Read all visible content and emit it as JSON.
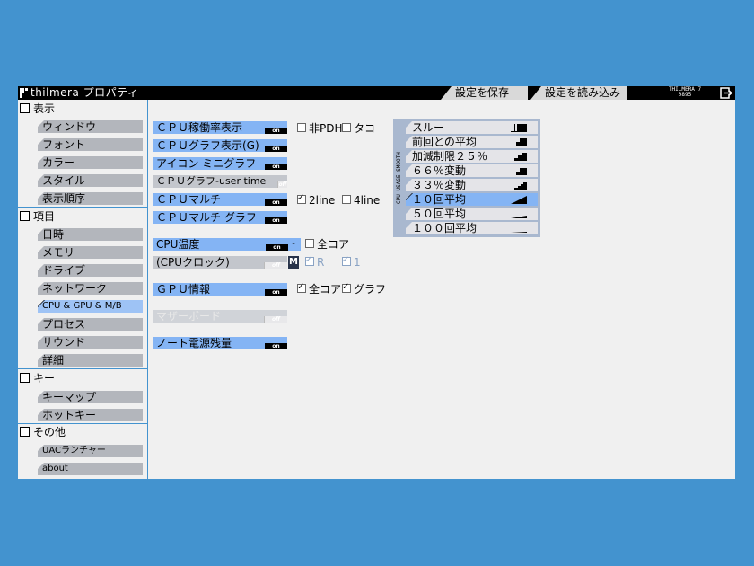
{
  "titlebar": {
    "title": "thilmera プロパティ",
    "save_label": "設定を保存",
    "load_label": "設定を読み込み",
    "brand_line1": "THILMERA 7",
    "brand_line2": "0895"
  },
  "sidebar": {
    "sections": [
      {
        "label": "表示",
        "items": [
          "ウィンドウ",
          "フォント",
          "カラー",
          "スタイル",
          "表示順序"
        ]
      },
      {
        "label": "項目",
        "items": [
          "日時",
          "メモリ",
          "ドライブ",
          "ネットワーク",
          "CPU & GPU & M/B",
          "プロセス",
          "サウンド",
          "詳細"
        ],
        "selected": "CPU & GPU & M/B"
      },
      {
        "label": "キー",
        "items": [
          "キーマップ",
          "ホットキー"
        ]
      },
      {
        "label": "その他",
        "items": [
          "UACランチャー",
          "about"
        ]
      }
    ]
  },
  "main": {
    "toggles": [
      {
        "label": "ＣＰＵ稼働率表示",
        "state": "on"
      },
      {
        "label": "ＣＰＵグラフ表示(G)",
        "state": "on"
      },
      {
        "label": "アイコン ミニグラフ",
        "state": "on"
      },
      {
        "label": "ＣＰＵグラフ-user time",
        "state": "off"
      },
      {
        "label": "ＣＰＵマルチ",
        "state": "on"
      },
      {
        "label": "ＣＰＵマルチ グラフ",
        "state": "on"
      },
      {
        "label": "CPU温度",
        "state": "on"
      },
      {
        "label": "(CPUクロック)",
        "state": "off"
      },
      {
        "label": "ＧＰＵ情報",
        "state": "on"
      },
      {
        "label": "マザーボード",
        "state": "off"
      },
      {
        "label": "ノート電源残量",
        "state": "on"
      }
    ],
    "temp_mini": "-",
    "clock_mini": "M",
    "options": {
      "pdh": "非PDH",
      "tako": "タコ",
      "line2": "2line",
      "line4": "4line",
      "allcore_temp": "全コア",
      "clock_r": "R",
      "clock_1": "1",
      "gpu_allcore": "全コア",
      "gpu_graph": "グラフ"
    }
  },
  "smoothing": {
    "panel_label": "CPU USAGE-SMOOTH",
    "items": [
      "スルー",
      "前回との平均",
      "加減制限２５％",
      "６６％変動",
      "３３％変動",
      "１０回平均",
      "５０回平均",
      "１００回平均"
    ],
    "selected": "１０回平均"
  },
  "colors": {
    "background": "#4393cf",
    "accent": "#84b4f4",
    "nav": "#b3b6bc",
    "titlebar": "#000000"
  }
}
